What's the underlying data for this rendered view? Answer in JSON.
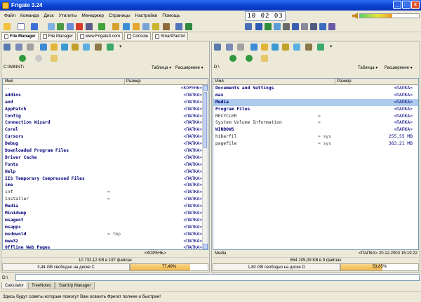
{
  "window": {
    "title": "Frigate 3.24"
  },
  "menu": [
    "Файл",
    "Команда",
    "Диск",
    "Утилиты",
    "Менеджер",
    "Страницы",
    "Настройки",
    "Помощь"
  ],
  "clock": "10 02 03",
  "volume": {
    "level": 0.55
  },
  "tabs": [
    {
      "label": "File Manager",
      "active": true
    },
    {
      "label": "File Manager",
      "active": false
    },
    {
      "label": "www.Frigate3.com",
      "active": false
    },
    {
      "label": "Console",
      "active": false
    },
    {
      "label": "SmartPad.txt",
      "active": false
    }
  ],
  "left_panel": {
    "path": "C:\\WINNT\\",
    "mode_table": "Таблица",
    "mode_ext": "Расширение",
    "col_name": "Имя",
    "col_size": "Размер",
    "rows": [
      {
        "name": "..",
        "ext": "",
        "size": "<КОРЕНЬ>",
        "kind": "file"
      },
      {
        "name": "addins",
        "ext": "",
        "size": "<ПАПКА>",
        "kind": "dir"
      },
      {
        "name": "aod",
        "ext": "",
        "size": "<ПАПКА>",
        "kind": "dir"
      },
      {
        "name": "AppPatch",
        "ext": "",
        "size": "<ПАПКА>",
        "kind": "dir"
      },
      {
        "name": "Config",
        "ext": "",
        "size": "<ПАПКА>",
        "kind": "dir"
      },
      {
        "name": "Connection Wizard",
        "ext": "",
        "size": "<ПАПКА>",
        "kind": "dir"
      },
      {
        "name": "Corel",
        "ext": "",
        "size": "<ПАПКА>",
        "kind": "dir"
      },
      {
        "name": "Cursors",
        "ext": "",
        "size": "<ПАПКА>",
        "kind": "dir"
      },
      {
        "name": "Debug",
        "ext": "",
        "size": "<ПАПКА>",
        "kind": "dir"
      },
      {
        "name": "Downloaded Program Files",
        "ext": "",
        "size": "<ПАПКА>",
        "kind": "dir"
      },
      {
        "name": "Driver Cache",
        "ext": "",
        "size": "<ПАПКА>",
        "kind": "dir"
      },
      {
        "name": "Fonts",
        "ext": "",
        "size": "<ПАПКА>",
        "kind": "dir"
      },
      {
        "name": "Help",
        "ext": "",
        "size": "<ПАПКА>",
        "kind": "dir"
      },
      {
        "name": "IIS Temporary Compressed Files",
        "ext": "",
        "size": "<ПАПКА>",
        "kind": "dir"
      },
      {
        "name": "ime",
        "ext": "",
        "size": "<ПАПКА>",
        "kind": "dir"
      },
      {
        "name": "inf",
        "ext": "=",
        "size": "<ПАПКА>",
        "kind": "file"
      },
      {
        "name": "Installer",
        "ext": "=",
        "size": "<ПАПКА>",
        "kind": "file"
      },
      {
        "name": "Media",
        "ext": "",
        "size": "<ПАПКА>",
        "kind": "dir"
      },
      {
        "name": "Minidump",
        "ext": "",
        "size": "<ПАПКА>",
        "kind": "dir"
      },
      {
        "name": "msagent",
        "ext": "",
        "size": "<ПАПКА>",
        "kind": "dir"
      },
      {
        "name": "msapps",
        "ext": "",
        "size": "<ПАПКА>",
        "kind": "dir"
      },
      {
        "name": "msdownld",
        "ext": "= tmp",
        "size": "<ПАПКА>",
        "kind": "dir"
      },
      {
        "name": "mww32",
        "ext": "",
        "size": "<ПАПКА>",
        "kind": "dir"
      },
      {
        "name": "Offline Web Pages",
        "ext": "",
        "size": "<ПАПКА>",
        "kind": "dir"
      }
    ],
    "info_left": "",
    "info_right": "<КОРЕНЬ>",
    "summary": "10 732,12 KB в 197 файлах",
    "free": "3,44 GB свободно на диске C",
    "usage_label": "77,49%",
    "usage": 0.7749
  },
  "right_panel": {
    "path": "D:\\",
    "mode_table": "Таблица",
    "mode_ext": "Расширение",
    "col_name": "Имя",
    "col_size": "Размер",
    "rows": [
      {
        "name": "Documents and Settings",
        "ext": "",
        "size": "<ПАПКА>",
        "kind": "dir"
      },
      {
        "name": "max",
        "ext": "",
        "size": "<ПАПКА>",
        "kind": "dir"
      },
      {
        "name": "Media",
        "ext": "",
        "size": "<ПАПКА>",
        "kind": "dir",
        "selected": true
      },
      {
        "name": "Program Files",
        "ext": "",
        "size": "<ПАПКА>",
        "kind": "dir"
      },
      {
        "name": "RECYCLER",
        "ext": "=",
        "size": "<ПАПКА>",
        "kind": "file"
      },
      {
        "name": "System Volume Information",
        "ext": "=",
        "size": "<ПАПКА>",
        "kind": "file"
      },
      {
        "name": "WINDOWS",
        "ext": "",
        "size": "<ПАПКА>",
        "kind": "dir"
      },
      {
        "name": "hiberfil",
        "ext": "= sys",
        "size": "255,55 MB",
        "kind": "file"
      },
      {
        "name": "pagefile",
        "ext": "= sys",
        "size": "383,21 MB",
        "kind": "file"
      }
    ],
    "info_left": "Media",
    "info_right": "<ПАПКА> 20.12.2003 15:19:22",
    "summary": "654 105,09 KB в 9 файлах",
    "free": "1,80 GB свободно на диске D",
    "usage_label": "53,85%",
    "usage": 0.5385
  },
  "cmdline": {
    "label": "D:\\",
    "value": ""
  },
  "bottom_tabs": [
    "Calculator",
    "TreeNotes",
    "StartUp Manager"
  ],
  "status": "Здесь будут советы которые помогут Вам освоить Фрегат полнее и быстрее!"
}
